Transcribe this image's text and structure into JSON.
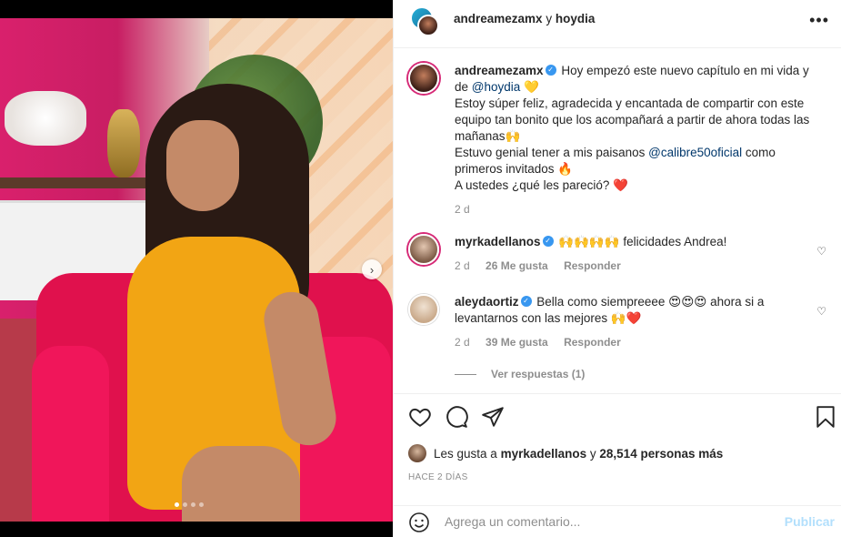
{
  "post": {
    "carousel_dots": 4,
    "active_dot": 0
  },
  "header": {
    "user1": "andreamezamx",
    "conjunction": "y",
    "user2": "hoydia"
  },
  "caption": {
    "username": "andreamezamx",
    "line1": "Hoy empezó este nuevo capítulo en mi vida y de",
    "mention1": "@hoydia",
    "line2": "Estoy súper feliz, agradecida y encantada de compartir con este equipo tan bonito que los acompañará a partir de ahora todas las mañanas",
    "line3a": "Estuvo genial tener a mis paisanos",
    "mention2": "@calibre50oficial",
    "line3b": "como primeros invitados",
    "line4": "A ustedes ¿qué les pareció?",
    "time": "2 d"
  },
  "comments": [
    {
      "username": "myrkadellanos",
      "text": "felicidades Andrea!",
      "time": "2 d",
      "likes": "26 Me gusta",
      "reply": "Responder"
    },
    {
      "username": "aleydaortiz",
      "text1": "Bella como siempreeee",
      "text2": "ahora si a levantarnos con las mejores",
      "time": "2 d",
      "likes": "39 Me gusta",
      "reply": "Responder"
    }
  ],
  "view_replies": "Ver respuestas (1)",
  "likes": {
    "prefix": "Les gusta a",
    "user": "myrkadellanos",
    "middle": "y",
    "count": "28,514 personas más"
  },
  "timestamp": "HACE 2 DÍAS",
  "add_comment": {
    "placeholder": "Agrega un comentario...",
    "publish": "Publicar"
  },
  "colors": {
    "verified": "#3897f0",
    "mention": "#00376b",
    "publish_disabled": "#b2dffc"
  }
}
